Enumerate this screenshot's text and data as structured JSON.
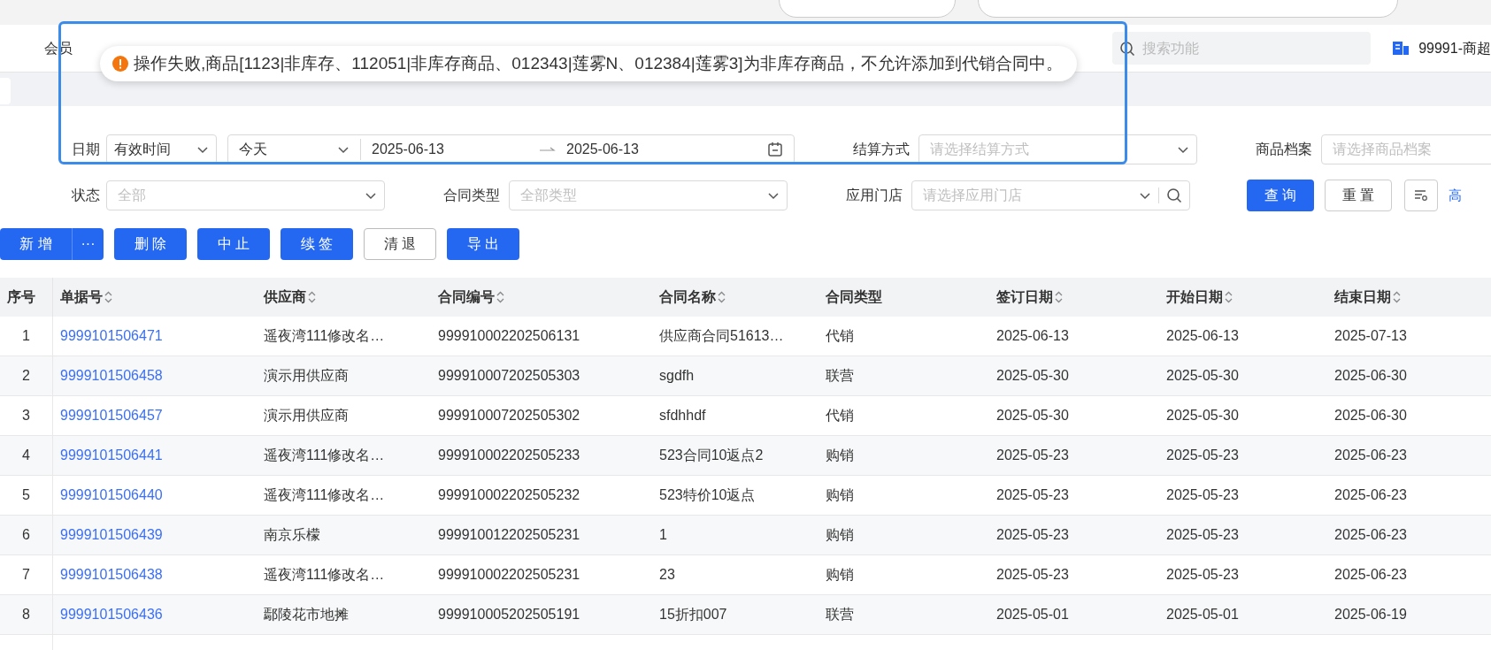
{
  "nav": {
    "items": [
      {
        "label": "会员"
      }
    ],
    "search_placeholder": "搜索功能",
    "store": "99991-商超"
  },
  "toast": {
    "kind": "error",
    "message": "操作失败,商品[1123|非库存、112051|非库存商品、012343|莲雾N、012384|莲雾3]为非库存商品，不允许添加到代销合同中。"
  },
  "filter_rows": [
    [
      {
        "kind": "date_range",
        "label": "日期",
        "mode": "有效时间",
        "preset": "今天",
        "start": "2025-06-13",
        "end": "2025-06-13"
      },
      {
        "kind": "select",
        "label": "结算方式",
        "placeholder": "请选择结算方式"
      },
      {
        "kind": "select",
        "label": "商品档案",
        "placeholder": "请选择商品档案"
      }
    ],
    [
      {
        "kind": "select",
        "label": "状态",
        "placeholder": "全部"
      },
      {
        "kind": "select",
        "label": "合同类型",
        "placeholder": "全部类型"
      },
      {
        "kind": "search_select",
        "label": "应用门店",
        "placeholder": "请选择应用门店"
      }
    ]
  ],
  "query_buttons": [
    {
      "kind": "primary",
      "label": "查 询"
    },
    {
      "kind": "outline",
      "label": "重 置"
    },
    {
      "kind": "icon"
    },
    {
      "kind": "link",
      "label": "高"
    }
  ],
  "actions": [
    {
      "kind": "split",
      "label": "新 增",
      "more": "···"
    },
    {
      "kind": "primary",
      "label": "删 除"
    },
    {
      "kind": "primary",
      "label": "中 止"
    },
    {
      "kind": "primary",
      "label": "续 签"
    },
    {
      "kind": "outline",
      "label": "清 退"
    },
    {
      "kind": "primary",
      "label": "导 出"
    }
  ],
  "table": {
    "columns": [
      {
        "label": "序号",
        "kind": "index",
        "sortable": false
      },
      {
        "label": "单据号",
        "kind": "link",
        "sortable": true
      },
      {
        "label": "供应商",
        "kind": "text",
        "sortable": true
      },
      {
        "label": "合同编号",
        "kind": "text",
        "sortable": true
      },
      {
        "label": "合同名称",
        "kind": "text",
        "sortable": true
      },
      {
        "label": "合同类型",
        "kind": "text",
        "sortable": false
      },
      {
        "label": "签订日期",
        "kind": "text",
        "sortable": true
      },
      {
        "label": "开始日期",
        "kind": "text",
        "sortable": true
      },
      {
        "label": "结束日期",
        "kind": "text",
        "sortable": true
      }
    ],
    "rows": [
      [
        "1",
        "9999101506471",
        "遥夜湾111修改名…",
        "999910002202506131",
        "供应商合同51613…",
        "代销",
        "2025-06-13",
        "2025-06-13",
        "2025-07-13"
      ],
      [
        "2",
        "9999101506458",
        "演示用供应商",
        "999910007202505303",
        "sgdfh",
        "联营",
        "2025-05-30",
        "2025-05-30",
        "2025-06-30"
      ],
      [
        "3",
        "9999101506457",
        "演示用供应商",
        "999910007202505302",
        "sfdhhdf",
        "代销",
        "2025-05-30",
        "2025-05-30",
        "2025-06-30"
      ],
      [
        "4",
        "9999101506441",
        "遥夜湾111修改名…",
        "999910002202505233",
        "523合同10返点2",
        "购销",
        "2025-05-23",
        "2025-05-23",
        "2025-06-23"
      ],
      [
        "5",
        "9999101506440",
        "遥夜湾111修改名…",
        "999910002202505232",
        "523特价10返点",
        "购销",
        "2025-05-23",
        "2025-05-23",
        "2025-06-23"
      ],
      [
        "6",
        "9999101506439",
        "南京乐檬",
        "999910012202505231",
        "1",
        "购销",
        "2025-05-23",
        "2025-05-23",
        "2025-06-23"
      ],
      [
        "7",
        "9999101506438",
        "遥夜湾111修改名…",
        "999910002202505231",
        "23",
        "购销",
        "2025-05-23",
        "2025-05-23",
        "2025-06-23"
      ],
      [
        "8",
        "9999101506436",
        "鄢陵花市地摊",
        "999910005202505191",
        "15折扣007",
        "联营",
        "2025-05-01",
        "2025-05-01",
        "2025-06-19"
      ]
    ]
  }
}
